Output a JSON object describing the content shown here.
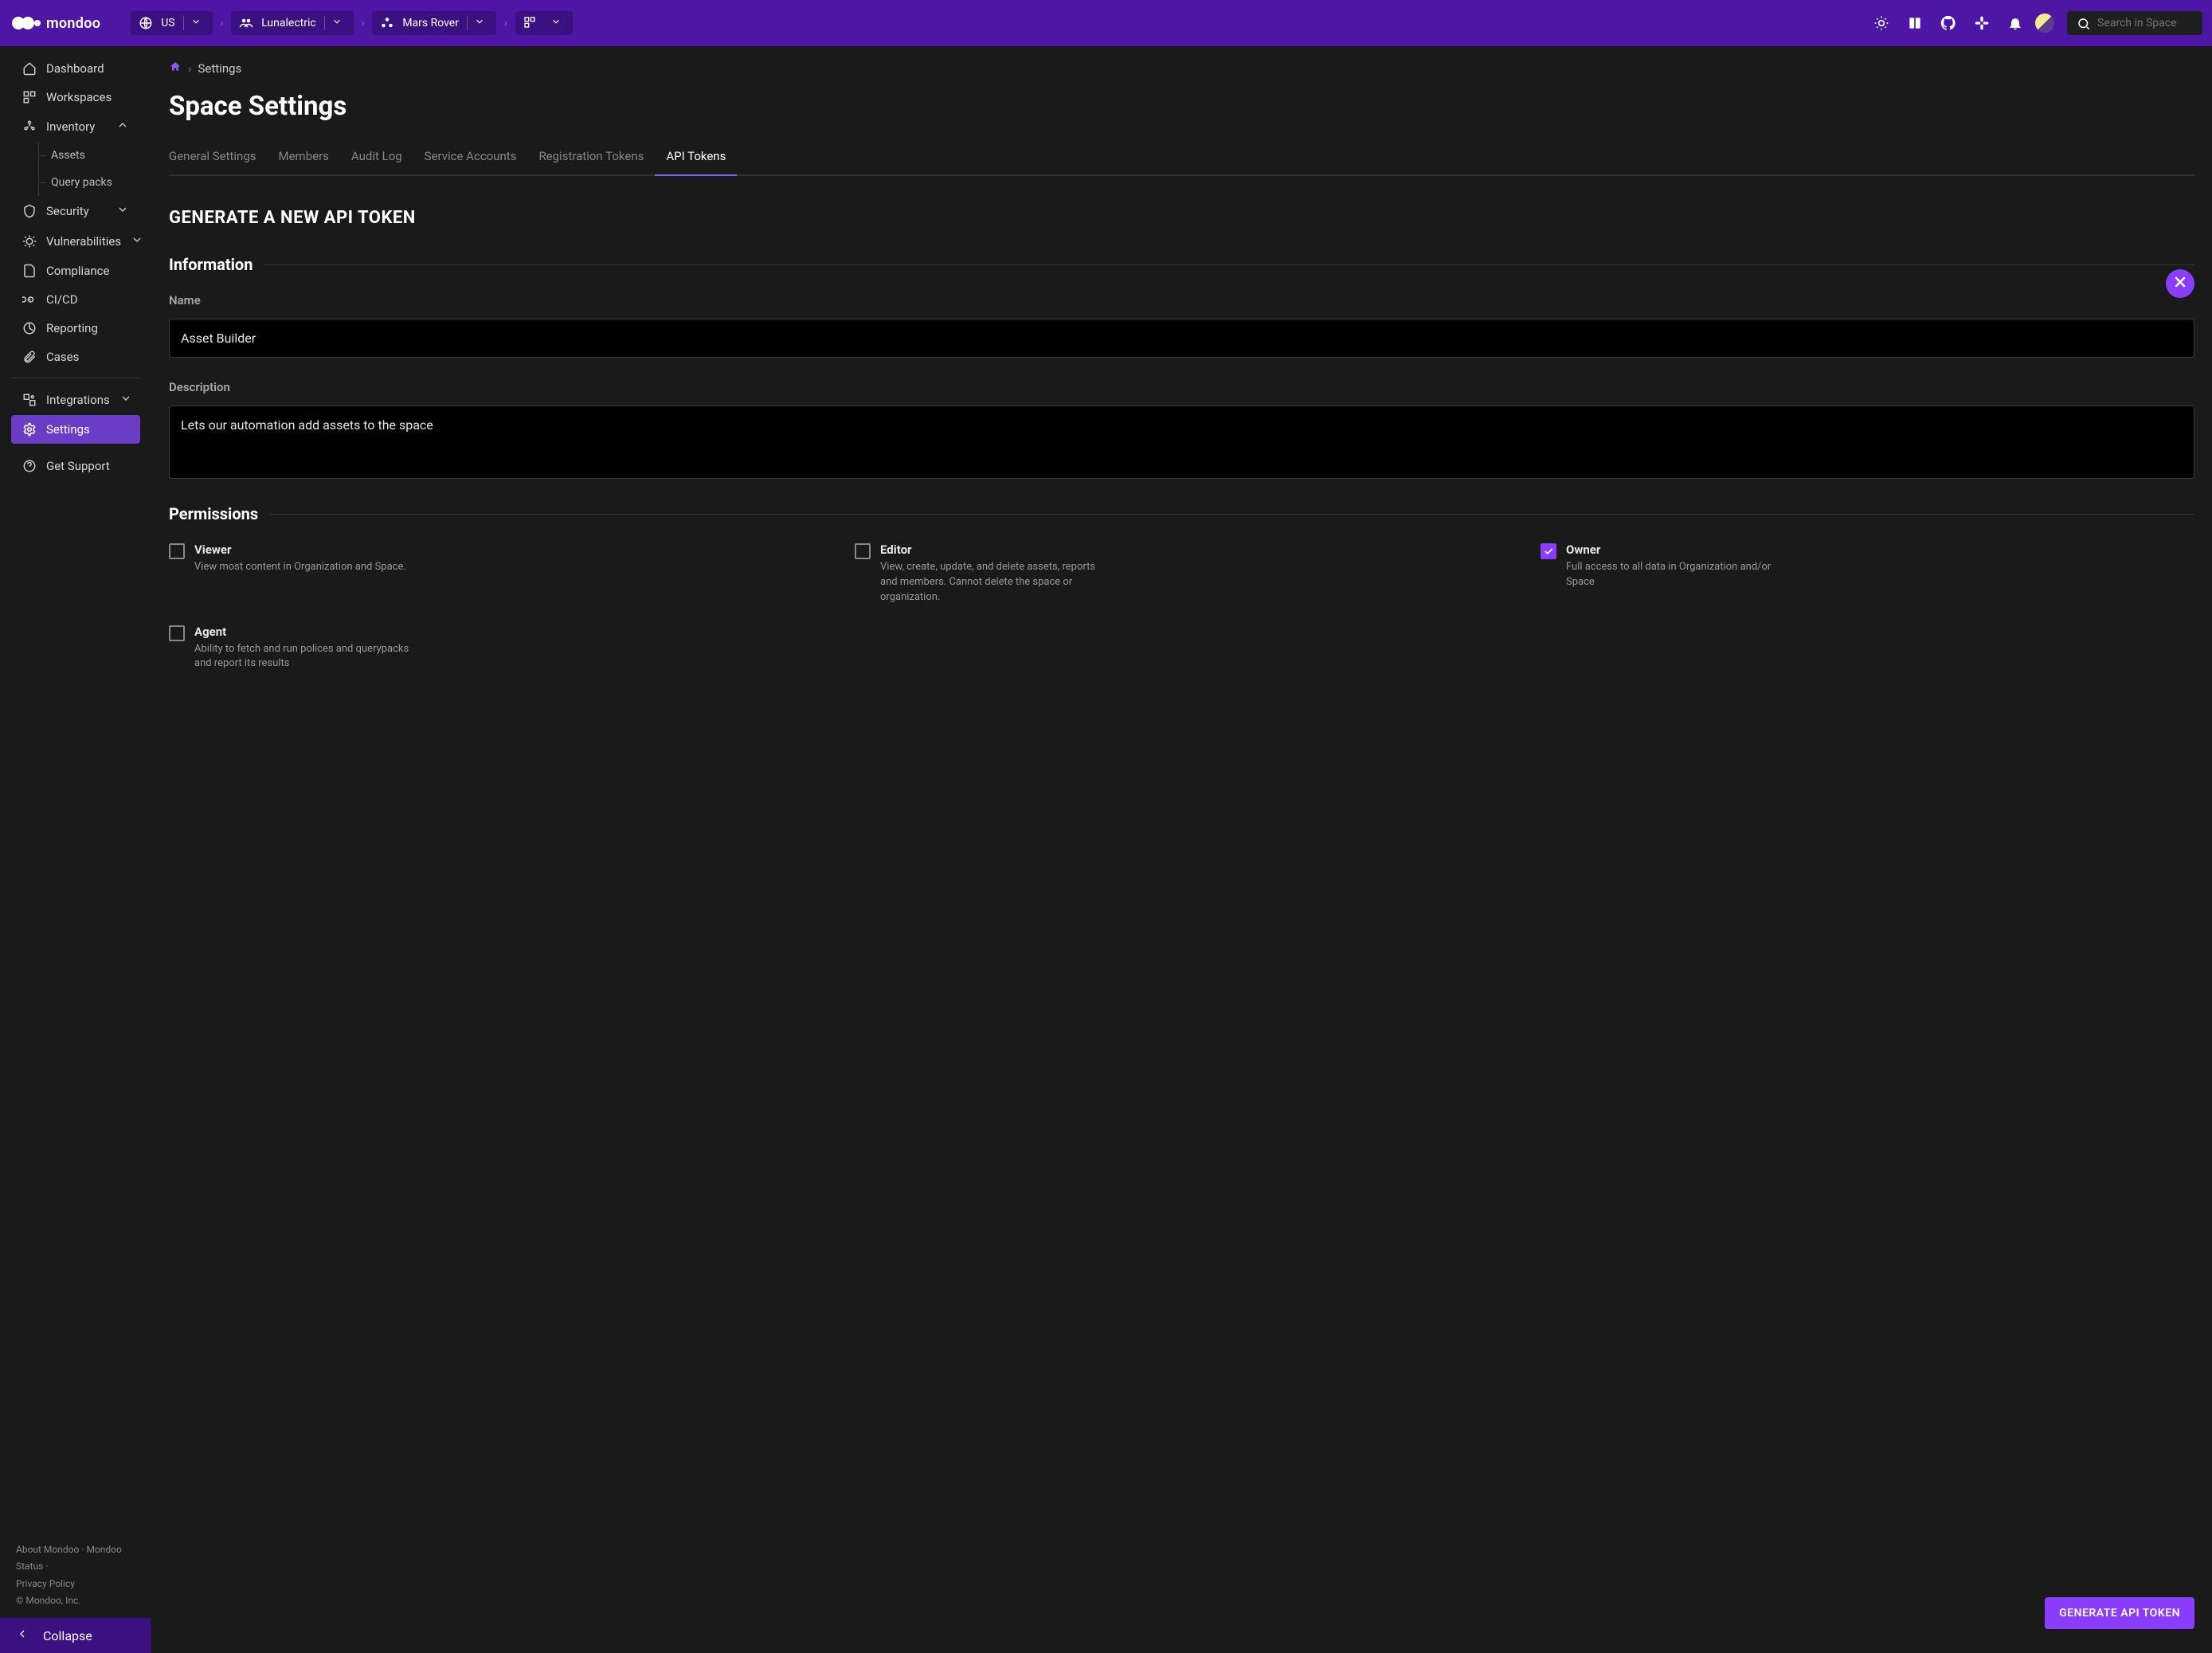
{
  "brand": "mondoo",
  "topbar": {
    "region": "US",
    "org": "Lunalectric",
    "space": "Mars Rover"
  },
  "search": {
    "placeholder": "Search in Space"
  },
  "sidebar": {
    "items": [
      {
        "label": "Dashboard"
      },
      {
        "label": "Workspaces"
      },
      {
        "label": "Inventory"
      },
      {
        "label": "Assets"
      },
      {
        "label": "Query packs"
      },
      {
        "label": "Security"
      },
      {
        "label": "Vulnerabilities"
      },
      {
        "label": "Compliance"
      },
      {
        "label": "CI/CD"
      },
      {
        "label": "Reporting"
      },
      {
        "label": "Cases"
      },
      {
        "label": "Integrations"
      },
      {
        "label": "Settings"
      },
      {
        "label": "Get Support"
      }
    ],
    "footer": {
      "about": "About Mondoo",
      "status": "Mondoo Status",
      "privacy": "Privacy Policy",
      "copyright": "© Mondoo, Inc."
    },
    "collapse": "Collapse"
  },
  "breadcrumb": {
    "current": "Settings"
  },
  "page": {
    "title": "Space Settings"
  },
  "tabs": [
    "General Settings",
    "Members",
    "Audit Log",
    "Service Accounts",
    "Registration Tokens",
    "API Tokens"
  ],
  "panel": {
    "title": "GENERATE A NEW API TOKEN",
    "section_info": "Information",
    "name_label": "Name",
    "name_value": "Asset Builder",
    "desc_label": "Description",
    "desc_value": "Lets our automation add assets to the space",
    "section_perms": "Permissions",
    "perms": [
      {
        "title": "Viewer",
        "desc": "View most content in Organization and Space.",
        "checked": false
      },
      {
        "title": "Editor",
        "desc": "View, create, update, and delete assets, reports and members. Cannot delete the space or organization.",
        "checked": false
      },
      {
        "title": "Owner",
        "desc": "Full access to all data in Organization and/or Space",
        "checked": true
      },
      {
        "title": "Agent",
        "desc": "Ability to fetch and run polices and querypacks and report its results",
        "checked": false
      }
    ],
    "button": "GENERATE API TOKEN"
  }
}
